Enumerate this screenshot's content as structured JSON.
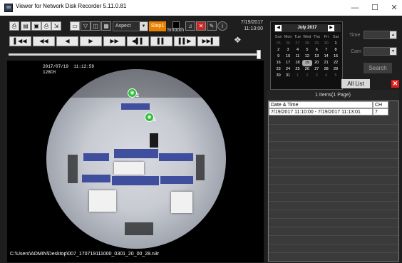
{
  "window": {
    "title": "Viewer for Network Disk Recorder 5.11.0.81",
    "controls": [
      "minimize-icon",
      "maximize-icon",
      "close-icon"
    ]
  },
  "toolbar": {
    "aspect_label": "Aspect",
    "step_label": "Step1",
    "smooth_label": "Smooth",
    "date": "7/19/2017",
    "time": "11:13:00"
  },
  "playback": {
    "buttons": [
      "skip-start",
      "fast-rewind",
      "reverse-play",
      "play",
      "fast-forward",
      "step-back",
      "pause",
      "step-forward",
      "skip-end"
    ],
    "position": 0.99
  },
  "video": {
    "overlay_date": "2017/07/19  11:12:59",
    "overlay_ch": "128CH",
    "marker_1": "2",
    "marker_2": "1",
    "file_path": "C:\\Users\\ADMIN\\Desktop\\007_170719111000_0301_20_00_28.n3r"
  },
  "calendar": {
    "month_title": "July 2017",
    "weekdays": [
      "Sun",
      "Mon",
      "Tue",
      "Wed",
      "Thu",
      "Fri",
      "Sat"
    ],
    "weeks": [
      [
        "25",
        "26",
        "27",
        "28",
        "29",
        "30",
        "1"
      ],
      [
        "2",
        "3",
        "4",
        "5",
        "6",
        "7",
        "8"
      ],
      [
        "9",
        "10",
        "11",
        "12",
        "13",
        "14",
        "15"
      ],
      [
        "16",
        "17",
        "18",
        "19",
        "20",
        "21",
        "22"
      ],
      [
        "23",
        "24",
        "25",
        "26",
        "27",
        "28",
        "29"
      ],
      [
        "30",
        "31",
        "1",
        "2",
        "3",
        "4",
        "5"
      ]
    ],
    "selected": "19"
  },
  "search": {
    "time_label": "Time",
    "cam_label": "Cam",
    "search_label": "Search"
  },
  "list": {
    "all_list_label": "All List",
    "count_text": "1 Items(1 Page)",
    "headers": [
      "Date & Time",
      "CH"
    ],
    "rows": [
      {
        "datetime": "7/19/2017 11:10:00 - 7/19/2017 11:13:01",
        "ch": "7"
      }
    ]
  },
  "colors": {
    "step_accent": "#e88000",
    "close_red": "#e41b1b",
    "marker_green": "#2bbf3a"
  }
}
